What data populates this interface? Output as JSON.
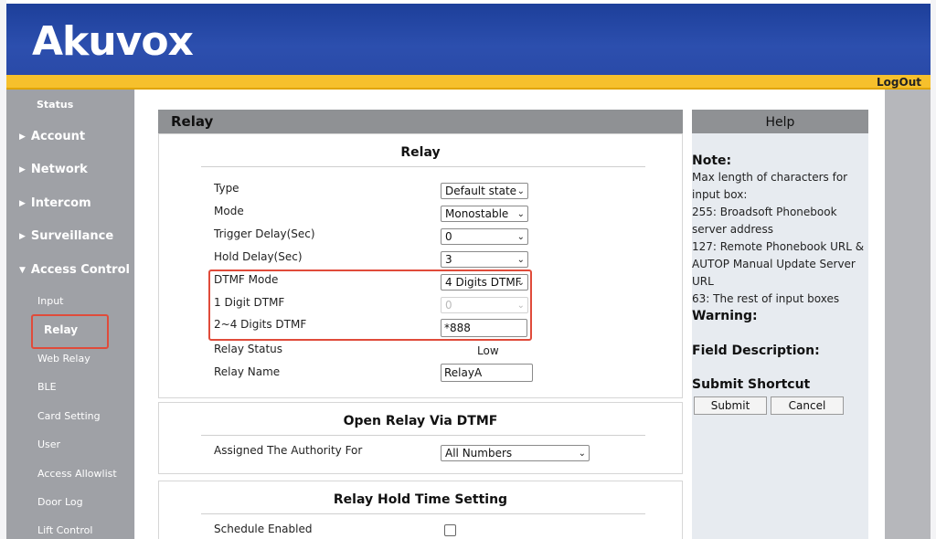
{
  "header": {
    "logo": "Akuvox",
    "logout": "LogOut"
  },
  "sidebar": {
    "items": [
      {
        "label": "Status"
      },
      {
        "label": "Account"
      },
      {
        "label": "Network"
      },
      {
        "label": "Intercom"
      },
      {
        "label": "Surveillance"
      },
      {
        "label": "Access Control"
      }
    ],
    "sub_items": [
      {
        "label": "Input"
      },
      {
        "label": "Relay"
      },
      {
        "label": "Web Relay"
      },
      {
        "label": "BLE"
      },
      {
        "label": "Card Setting"
      },
      {
        "label": "User"
      },
      {
        "label": "Access Allowlist"
      },
      {
        "label": "Door Log"
      },
      {
        "label": "Lift Control"
      }
    ]
  },
  "main": {
    "panel_title": "Relay",
    "relay_section": {
      "title": "Relay",
      "fields": {
        "type": {
          "label": "Type",
          "value": "Default state"
        },
        "mode": {
          "label": "Mode",
          "value": "Monostable"
        },
        "trigger_delay": {
          "label": "Trigger Delay(Sec)",
          "value": "0"
        },
        "hold_delay": {
          "label": "Hold Delay(Sec)",
          "value": "3"
        },
        "dtmf_mode": {
          "label": "DTMF Mode",
          "value": "4 Digits DTMF"
        },
        "one_digit_dtmf": {
          "label": "1 Digit DTMF",
          "value": "0"
        },
        "multi_digit_dtmf": {
          "label": "2~4 Digits DTMF",
          "value": "*888"
        },
        "relay_status": {
          "label": "Relay Status",
          "value": "Low"
        },
        "relay_name": {
          "label": "Relay Name",
          "value": "RelayA"
        }
      }
    },
    "open_relay_section": {
      "title": "Open Relay Via DTMF",
      "assigned": {
        "label": "Assigned The Authority For",
        "value": "All Numbers"
      }
    },
    "hold_time_section": {
      "title": "Relay Hold Time Setting",
      "schedule": {
        "label": "Schedule Enabled",
        "checked": false
      }
    }
  },
  "help": {
    "title": "Help",
    "note_title": "Note:",
    "note_lines": [
      "Max length of characters for input box:",
      "255: Broadsoft Phonebook server address",
      "127: Remote Phonebook URL & AUTOP Manual Update Server URL",
      "63: The rest of input boxes"
    ],
    "warning_title": "Warning:",
    "field_desc_title": "Field Description:",
    "submit_shortcut_title": "Submit Shortcut",
    "submit_label": "Submit",
    "cancel_label": "Cancel"
  },
  "colors": {
    "header_blue": "#2c4fae",
    "accent_yellow": "#f6c02c",
    "highlight_red": "#e04b3a",
    "sidebar_gray": "#9fa1a6"
  }
}
